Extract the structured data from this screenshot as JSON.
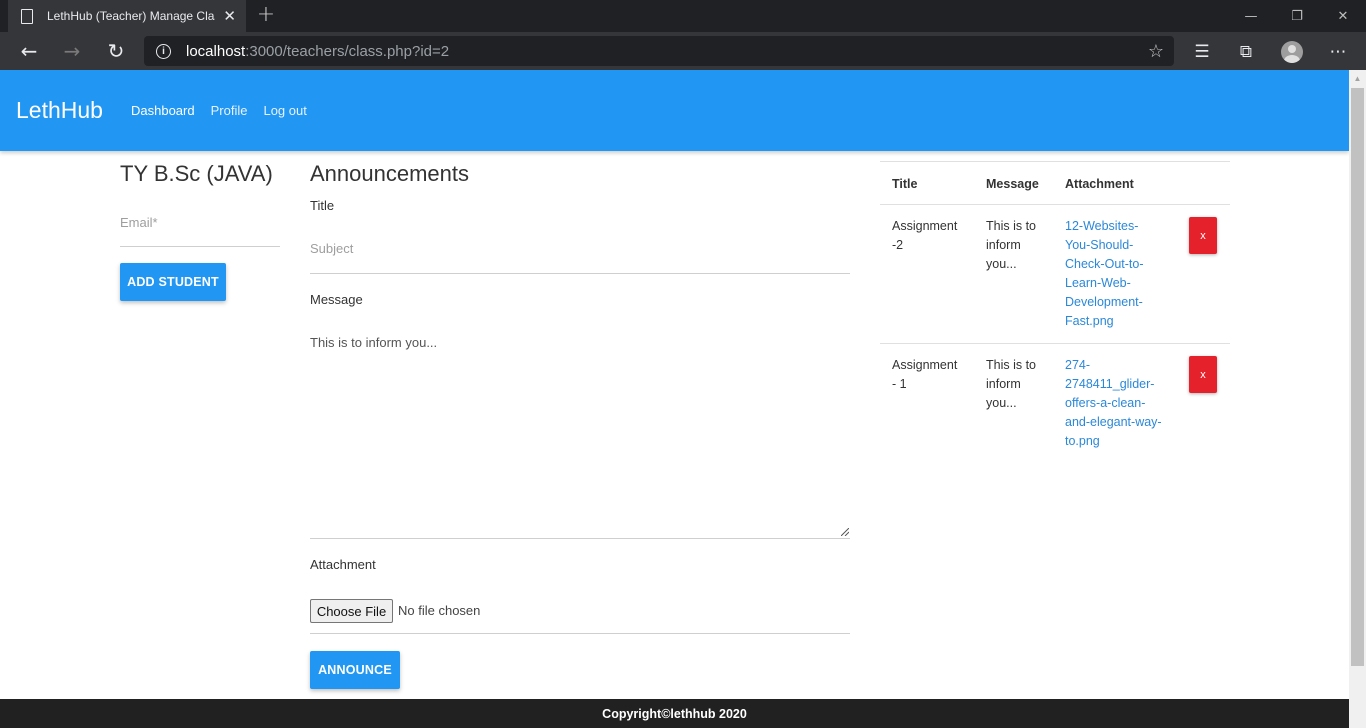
{
  "browser": {
    "tab_title": "LethHub (Teacher) Manage Class",
    "tab_close": "✕",
    "new_tab": "+",
    "url_host": "localhost",
    "url_rest": ":3000/teachers/class.php?id=2",
    "window_minimize": "—",
    "window_restore": "❐",
    "window_close": "✕"
  },
  "navbar": {
    "brand": "LethHub",
    "links": [
      "Dashboard",
      "Profile",
      "Log out"
    ]
  },
  "left": {
    "class_title": "TY B.Sc (JAVA)",
    "email_placeholder": "Email*",
    "add_student_label": "ADD STUDENT"
  },
  "announce": {
    "heading": "Announcements",
    "title_label": "Title",
    "subject_placeholder": "Subject",
    "message_label": "Message",
    "message_value": "This is to inform you...",
    "attachment_label": "Attachment",
    "choose_file_label": "Choose File",
    "file_status": "No file chosen",
    "announce_label": "ANNOUNCE"
  },
  "table": {
    "headers": [
      "Title",
      "Message",
      "Attachment"
    ],
    "rows": [
      {
        "title_lines": [
          "Assignment",
          "-2"
        ],
        "message_lines": [
          "This is to",
          "inform",
          "you..."
        ],
        "attachment_lines": [
          "12-Websites-",
          "You-Should-",
          "Check-Out-to-",
          "Learn-Web-",
          "Development-",
          "Fast.png"
        ],
        "delete_label": "x"
      },
      {
        "title_lines": [
          "Assignment",
          "- 1"
        ],
        "message_lines": [
          "This is to",
          "inform",
          "you..."
        ],
        "attachment_lines": [
          "274-",
          "2748411_glider-",
          "offers-a-clean-",
          "and-elegant-way-",
          "to.png"
        ],
        "delete_label": "x"
      }
    ]
  },
  "footer": {
    "text": "Copyright©lethhub 2020"
  },
  "colors": {
    "primary": "#2196f3",
    "danger": "#e5222b",
    "link": "#2b88d8",
    "footer": "#212121"
  }
}
